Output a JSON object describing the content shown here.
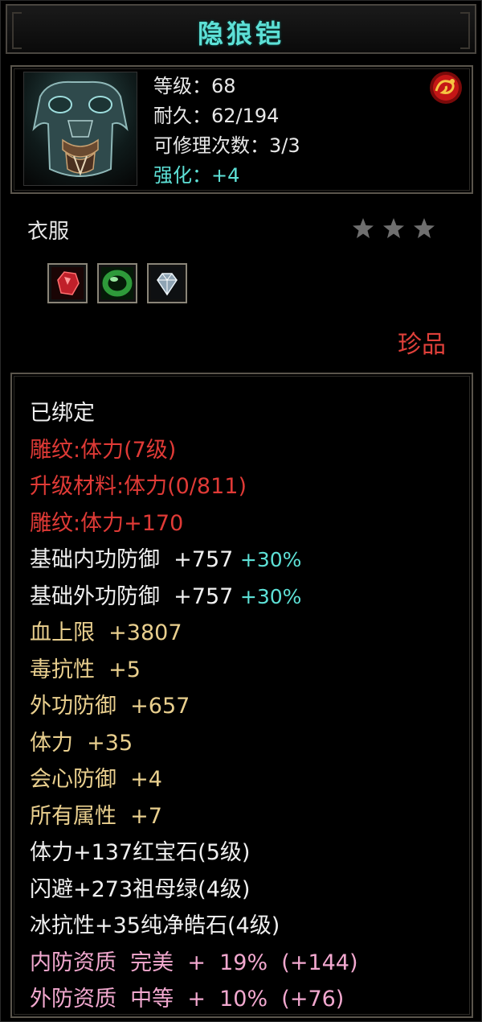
{
  "window": {
    "title": "隐狼铠"
  },
  "item": {
    "image_icon": "armor-icon",
    "badge_icon": "dragon-gem-icon",
    "stats": {
      "level": "等级：68",
      "durability": "耐久：62/194",
      "repairs": "可修理次数：3/3",
      "enhance": "强化：+4"
    },
    "category": "衣服",
    "stars": 3,
    "sockets": [
      {
        "icon": "ruby-icon",
        "color": "#c0202a"
      },
      {
        "icon": "emerald-icon",
        "color": "#2e9a3a"
      },
      {
        "icon": "diamond-icon",
        "color": "#d8e6ef"
      }
    ],
    "rarity": "珍品"
  },
  "attributes": {
    "bound": "已绑定",
    "engrave": "雕纹:体力(7级)",
    "upgrade_material": "升级材料:体力(0/811)",
    "engrave_bonus": "雕纹:体力+170",
    "base_inner_def": "基础内功防御  +757",
    "base_inner_def_pct": "+30%",
    "base_outer_def": "基础外功防御  +757",
    "base_outer_def_pct": "+30%",
    "hp_max": "血上限  +3807",
    "poison_res": "毒抗性  +5",
    "outer_def": "外功防御  +657",
    "stamina": "体力  +35",
    "crit_def": "会心防御  +4",
    "all_attr": "所有属性  +7",
    "gem1": "体力+137红宝石(5级)",
    "gem2": "闪避+273祖母绿(4级)",
    "gem3": "冰抗性+35纯净皓石(4级)",
    "quality_inner": "内防资质  完美  +  19%  (+144)",
    "quality_outer": "外防资质  中等  +  10%  (+76)"
  },
  "colors": {
    "title": "#5de0d6",
    "rarity": "#e0403a",
    "engrave": "#e03a36",
    "attribute": "#e9cf8e",
    "quality": "#f2a8cf"
  }
}
